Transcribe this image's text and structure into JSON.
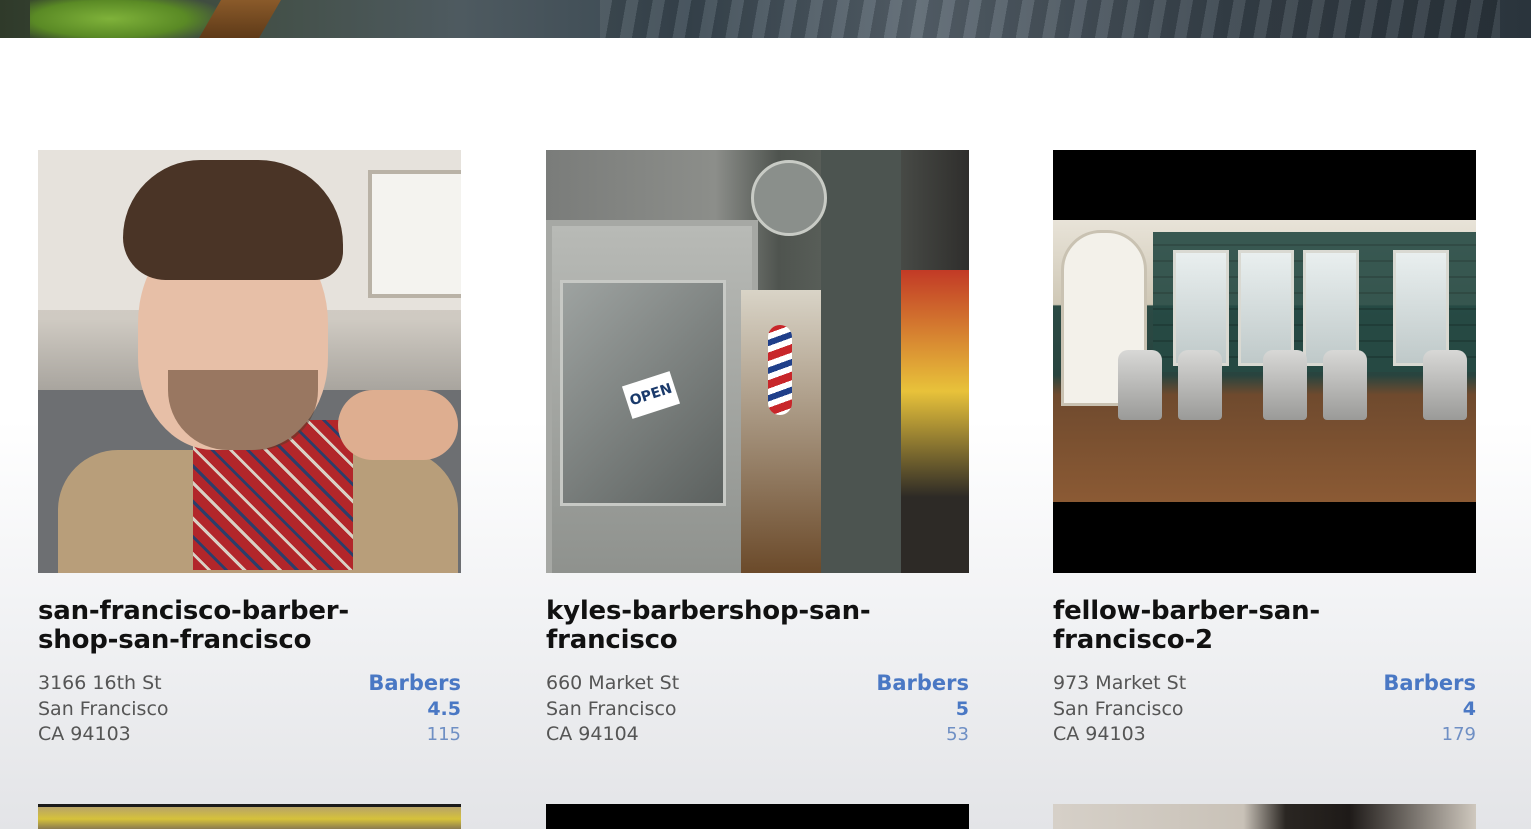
{
  "listings": [
    {
      "name": "san-francisco-barber-shop-san-francisco",
      "name_line1": "san-francisco-barber-",
      "name_line2": "shop-san-francisco",
      "street": "3166 16th St",
      "city": "San Francisco",
      "state_zip": "CA 94103",
      "category": "Barbers",
      "rating": "4.5",
      "review_count": "115"
    },
    {
      "name": "kyles-barbershop-san-francisco",
      "name_line1": "kyles-barbershop-san-",
      "name_line2": "francisco",
      "street": "660 Market St",
      "city": "San Francisco",
      "state_zip": "CA 94104",
      "category": "Barbers",
      "rating": "5",
      "review_count": "53",
      "photo_sign": "OPEN"
    },
    {
      "name": "fellow-barber-san-francisco-2",
      "name_line1": "fellow-barber-san-",
      "name_line2": "francisco-2",
      "street": "973 Market St",
      "city": "San Francisco",
      "state_zip": "CA 94103",
      "category": "Barbers",
      "rating": "4",
      "review_count": "179"
    }
  ],
  "colors": {
    "accent": "#4a78c4",
    "title": "#111111",
    "address": "#555555"
  }
}
